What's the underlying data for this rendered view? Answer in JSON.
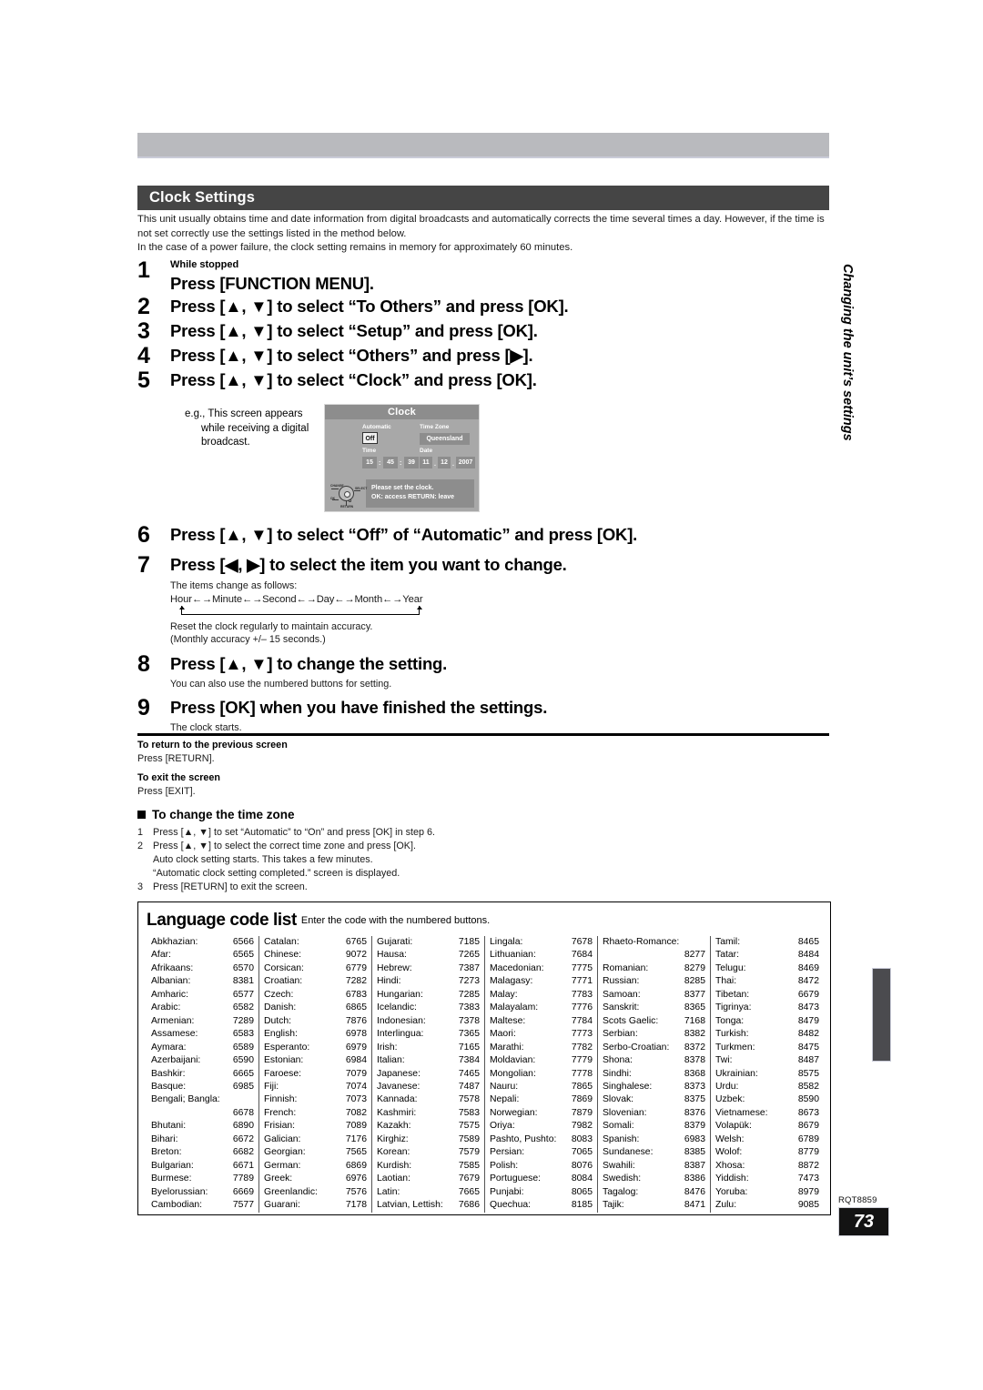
{
  "header": {
    "title": "Clock Settings"
  },
  "intro": {
    "line1": "This unit usually obtains time and date information from digital broadcasts and automatically corrects the time several times a day. However, if the time is not set correctly use the settings listed in the method below.",
    "line2": "In the case of a power failure, the clock setting remains in memory for approximately 60 minutes."
  },
  "steps": [
    {
      "num": "1",
      "pre": "While stopped",
      "text": "Press [FUNCTION MENU]."
    },
    {
      "num": "2",
      "text": "Press [▲, ▼] to select “To Others” and press [OK]."
    },
    {
      "num": "3",
      "text": "Press [▲, ▼] to select “Setup” and press [OK]."
    },
    {
      "num": "4",
      "text": "Press [▲, ▼] to select “Others” and press [▶]."
    },
    {
      "num": "5",
      "text": "Press [▲, ▼] to select “Clock” and press [OK]."
    },
    {
      "num": "6",
      "text": "Press [▲, ▼] to select “Off” of “Automatic” and press [OK]."
    },
    {
      "num": "7",
      "text": "Press [◀, ▶] to select the item you want to change."
    },
    {
      "num": "8",
      "text": "Press [▲, ▼] to change the setting."
    },
    {
      "num": "9",
      "text": "Press [OK] when you have finished the settings."
    }
  ],
  "example": {
    "line1": "e.g., This screen appears",
    "line2": "while receiving a digital",
    "line3": "broadcast."
  },
  "tv_screen": {
    "title": "Clock",
    "automatic_label": "Automatic",
    "automatic_value": "Off",
    "timezone_label": "Time Zone",
    "timezone_value": "Queensland",
    "time_label": "Time",
    "time_hour": "15",
    "time_minute": "45",
    "time_second": "39",
    "time_sep": ":",
    "date_label": "Date",
    "date_day": "11",
    "date_month": "12",
    "date_year": "2007",
    "date_sep": ".",
    "message_line1": "Please set the clock.",
    "message_line2": "OK:  access      RETURN:  leave",
    "dpad_change": "CHANGE",
    "dpad_select": "SELECT",
    "dpad_ok": "OK",
    "dpad_return": "RETURN"
  },
  "step7_detail": {
    "intro": "The items change as follows:",
    "sequence": "Hour←→Minute←→Second←→Day←→Month←→Year",
    "note1": "Reset the clock regularly to maintain accuracy.",
    "note2": "(Monthly accuracy +/– 15 seconds.)"
  },
  "step8_detail": {
    "note": "You can also use the numbered buttons for setting."
  },
  "step9_detail": {
    "note": "The clock starts."
  },
  "notes": {
    "return_heading": "To return to the previous screen",
    "return_body": "Press [RETURN].",
    "exit_heading": "To exit the screen",
    "exit_body": "Press [EXIT]."
  },
  "timezone_section": {
    "heading": "To change the time zone",
    "items": [
      {
        "n": "1",
        "text": "Press [▲, ▼] to set “Automatic” to “On” and press [OK] in step 6."
      },
      {
        "n": "2",
        "text": "Press [▲, ▼] to select the correct time zone and press [OK]."
      },
      {
        "n": "3",
        "text": "Press [RETURN] to exit the screen."
      }
    ],
    "sub_lines": [
      "Auto clock setting starts. This takes a few minutes.",
      "“Automatic clock setting completed.” screen is displayed."
    ]
  },
  "language_list": {
    "title": "Language code list",
    "subtitle": "Enter the code with the numbered buttons.",
    "columns": [
      [
        {
          "name": "Abkhazian:",
          "code": "6566"
        },
        {
          "name": "Afar:",
          "code": "6565"
        },
        {
          "name": "Afrikaans:",
          "code": "6570"
        },
        {
          "name": "Albanian:",
          "code": "8381"
        },
        {
          "name": "Amharic:",
          "code": "6577"
        },
        {
          "name": "Arabic:",
          "code": "6582"
        },
        {
          "name": "Armenian:",
          "code": "7289"
        },
        {
          "name": "Assamese:",
          "code": "6583"
        },
        {
          "name": "Aymara:",
          "code": "6589"
        },
        {
          "name": "Azerbaijani:",
          "code": "6590"
        },
        {
          "name": "Bashkir:",
          "code": "6665"
        },
        {
          "name": "Basque:",
          "code": "6985"
        },
        {
          "name": "Bengali; Bangla:",
          "code": ""
        },
        {
          "name": "",
          "code": "6678"
        },
        {
          "name": "Bhutani:",
          "code": "6890"
        },
        {
          "name": "Bihari:",
          "code": "6672"
        },
        {
          "name": "Breton:",
          "code": "6682"
        },
        {
          "name": "Bulgarian:",
          "code": "6671"
        },
        {
          "name": "Burmese:",
          "code": "7789"
        },
        {
          "name": "Byelorussian:",
          "code": "6669"
        },
        {
          "name": "Cambodian:",
          "code": "7577"
        }
      ],
      [
        {
          "name": "Catalan:",
          "code": "6765"
        },
        {
          "name": "Chinese:",
          "code": "9072"
        },
        {
          "name": "Corsican:",
          "code": "6779"
        },
        {
          "name": "Croatian:",
          "code": "7282"
        },
        {
          "name": "Czech:",
          "code": "6783"
        },
        {
          "name": "Danish:",
          "code": "6865"
        },
        {
          "name": "Dutch:",
          "code": "7876"
        },
        {
          "name": "English:",
          "code": "6978"
        },
        {
          "name": "Esperanto:",
          "code": "6979"
        },
        {
          "name": "Estonian:",
          "code": "6984"
        },
        {
          "name": "Faroese:",
          "code": "7079"
        },
        {
          "name": "Fiji:",
          "code": "7074"
        },
        {
          "name": "Finnish:",
          "code": "7073"
        },
        {
          "name": "French:",
          "code": "7082"
        },
        {
          "name": "Frisian:",
          "code": "7089"
        },
        {
          "name": "Galician:",
          "code": "7176"
        },
        {
          "name": "Georgian:",
          "code": "7565"
        },
        {
          "name": "German:",
          "code": "6869"
        },
        {
          "name": "Greek:",
          "code": "6976"
        },
        {
          "name": "Greenlandic:",
          "code": "7576"
        },
        {
          "name": "Guarani:",
          "code": "7178"
        }
      ],
      [
        {
          "name": "Gujarati:",
          "code": "7185"
        },
        {
          "name": "Hausa:",
          "code": "7265"
        },
        {
          "name": "Hebrew:",
          "code": "7387"
        },
        {
          "name": "Hindi:",
          "code": "7273"
        },
        {
          "name": "Hungarian:",
          "code": "7285"
        },
        {
          "name": "Icelandic:",
          "code": "7383"
        },
        {
          "name": "Indonesian:",
          "code": "7378"
        },
        {
          "name": "Interlingua:",
          "code": "7365"
        },
        {
          "name": "Irish:",
          "code": "7165"
        },
        {
          "name": "Italian:",
          "code": "7384"
        },
        {
          "name": "Japanese:",
          "code": "7465"
        },
        {
          "name": "Javanese:",
          "code": "7487"
        },
        {
          "name": "Kannada:",
          "code": "7578"
        },
        {
          "name": "Kashmiri:",
          "code": "7583"
        },
        {
          "name": "Kazakh:",
          "code": "7575"
        },
        {
          "name": "Kirghiz:",
          "code": "7589"
        },
        {
          "name": "Korean:",
          "code": "7579"
        },
        {
          "name": "Kurdish:",
          "code": "7585"
        },
        {
          "name": "Laotian:",
          "code": "7679"
        },
        {
          "name": "Latin:",
          "code": "7665"
        },
        {
          "name": "Latvian, Lettish:",
          "code": "7686"
        }
      ],
      [
        {
          "name": "Lingala:",
          "code": "7678"
        },
        {
          "name": "Lithuanian:",
          "code": "7684"
        },
        {
          "name": "Macedonian:",
          "code": "7775"
        },
        {
          "name": "Malagasy:",
          "code": "7771"
        },
        {
          "name": "Malay:",
          "code": "7783"
        },
        {
          "name": "Malayalam:",
          "code": "7776"
        },
        {
          "name": "Maltese:",
          "code": "7784"
        },
        {
          "name": "Maori:",
          "code": "7773"
        },
        {
          "name": "Marathi:",
          "code": "7782"
        },
        {
          "name": "Moldavian:",
          "code": "7779"
        },
        {
          "name": "Mongolian:",
          "code": "7778"
        },
        {
          "name": "Nauru:",
          "code": "7865"
        },
        {
          "name": "Nepali:",
          "code": "7869"
        },
        {
          "name": "Norwegian:",
          "code": "7879"
        },
        {
          "name": "Oriya:",
          "code": "7982"
        },
        {
          "name": "Pashto, Pushto:",
          "code": "8083"
        },
        {
          "name": "Persian:",
          "code": "7065"
        },
        {
          "name": "Polish:",
          "code": "8076"
        },
        {
          "name": "Portuguese:",
          "code": "8084"
        },
        {
          "name": "Punjabi:",
          "code": "8065"
        },
        {
          "name": "Quechua:",
          "code": "8185"
        }
      ],
      [
        {
          "name": "Rhaeto-Romance:",
          "code": ""
        },
        {
          "name": "",
          "code": "8277"
        },
        {
          "name": "Romanian:",
          "code": "8279"
        },
        {
          "name": "Russian:",
          "code": "8285"
        },
        {
          "name": "Samoan:",
          "code": "8377"
        },
        {
          "name": "Sanskrit:",
          "code": "8365"
        },
        {
          "name": "Scots Gaelic:",
          "code": "7168"
        },
        {
          "name": "Serbian:",
          "code": "8382"
        },
        {
          "name": "Serbo-Croatian:",
          "code": "8372"
        },
        {
          "name": "Shona:",
          "code": "8378"
        },
        {
          "name": "Sindhi:",
          "code": "8368"
        },
        {
          "name": "Singhalese:",
          "code": "8373"
        },
        {
          "name": "Slovak:",
          "code": "8375"
        },
        {
          "name": "Slovenian:",
          "code": "8376"
        },
        {
          "name": "Somali:",
          "code": "8379"
        },
        {
          "name": "Spanish:",
          "code": "6983"
        },
        {
          "name": "Sundanese:",
          "code": "8385"
        },
        {
          "name": "Swahili:",
          "code": "8387"
        },
        {
          "name": "Swedish:",
          "code": "8386"
        },
        {
          "name": "Tagalog:",
          "code": "8476"
        },
        {
          "name": "Tajik:",
          "code": "8471"
        }
      ],
      [
        {
          "name": "Tamil:",
          "code": "8465"
        },
        {
          "name": "Tatar:",
          "code": "8484"
        },
        {
          "name": "Telugu:",
          "code": "8469"
        },
        {
          "name": "Thai:",
          "code": "8472"
        },
        {
          "name": "Tibetan:",
          "code": "6679"
        },
        {
          "name": "Tigrinya:",
          "code": "8473"
        },
        {
          "name": "Tonga:",
          "code": "8479"
        },
        {
          "name": "Turkish:",
          "code": "8482"
        },
        {
          "name": "Turkmen:",
          "code": "8475"
        },
        {
          "name": "Twi:",
          "code": "8487"
        },
        {
          "name": "Ukrainian:",
          "code": "8575"
        },
        {
          "name": "Urdu:",
          "code": "8582"
        },
        {
          "name": "Uzbek:",
          "code": "8590"
        },
        {
          "name": "Vietnamese:",
          "code": "8673"
        },
        {
          "name": "Volapük:",
          "code": "8679"
        },
        {
          "name": "Welsh:",
          "code": "6789"
        },
        {
          "name": "Wolof:",
          "code": "8779"
        },
        {
          "name": "Xhosa:",
          "code": "8872"
        },
        {
          "name": "Yiddish:",
          "code": "7473"
        },
        {
          "name": "Yoruba:",
          "code": "8979"
        },
        {
          "name": "Zulu:",
          "code": "9085"
        }
      ]
    ]
  },
  "side_tab": {
    "label": "Changing the unit’s settings"
  },
  "footer": {
    "doc_code": "RQT8859",
    "page_number": "73"
  }
}
